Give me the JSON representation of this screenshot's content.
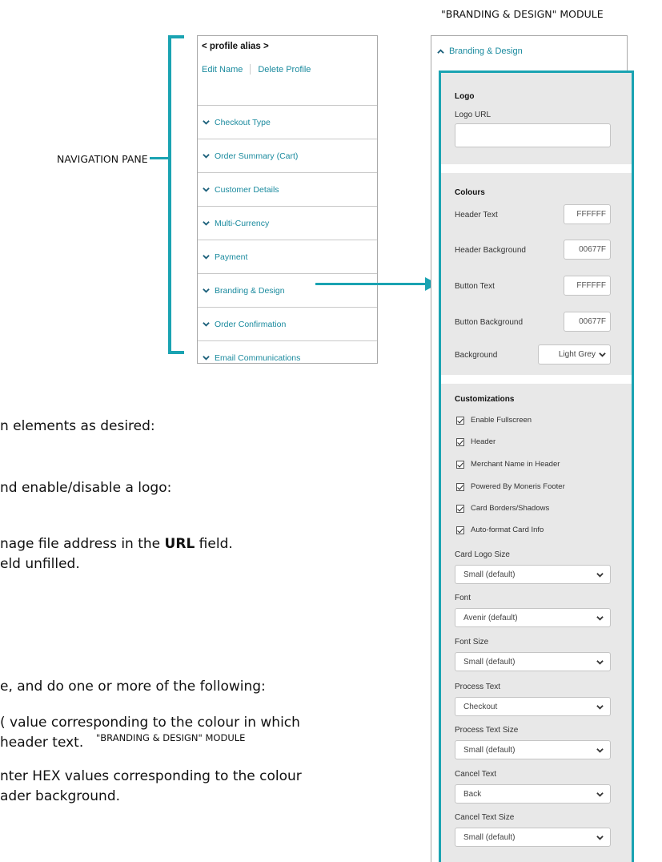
{
  "captions": {
    "module_top": "\"BRANDING & DESIGN\" MODULE",
    "module_overlay": "\"BRANDING & DESIGN\" MODULE",
    "nav_pane": "NAVIGATION PANE"
  },
  "nav": {
    "alias": "< profile alias >",
    "edit_name": "Edit Name",
    "delete_profile": "Delete Profile",
    "items": [
      {
        "label": "Checkout Type"
      },
      {
        "label": "Order Summary (Cart)"
      },
      {
        "label": "Customer Details"
      },
      {
        "label": "Multi-Currency"
      },
      {
        "label": "Payment"
      },
      {
        "label": "Branding & Design"
      },
      {
        "label": "Order Confirmation"
      },
      {
        "label": "Email Communications"
      }
    ]
  },
  "module": {
    "header": "Branding & Design",
    "logo": {
      "title": "Logo",
      "url_label": "Logo URL",
      "url_value": ""
    },
    "colours": {
      "title": "Colours",
      "header_text_label": "Header Text",
      "header_text_value": "FFFFFF",
      "header_bg_label": "Header Background",
      "header_bg_value": "00677F",
      "button_text_label": "Button Text",
      "button_text_value": "FFFFFF",
      "button_bg_label": "Button Background",
      "button_bg_value": "00677F",
      "background_label": "Background",
      "background_value": "Light Grey"
    },
    "customizations": {
      "title": "Customizations",
      "checkboxes": [
        {
          "label": "Enable Fullscreen",
          "checked": true
        },
        {
          "label": "Header",
          "checked": true
        },
        {
          "label": "Merchant Name in Header",
          "checked": true
        },
        {
          "label": "Powered By Moneris Footer",
          "checked": true
        },
        {
          "label": "Card Borders/Shadows",
          "checked": true
        },
        {
          "label": "Auto-format Card Info",
          "checked": true
        }
      ],
      "card_logo_size_label": "Card Logo Size",
      "card_logo_size_value": "Small (default)",
      "font_label": "Font",
      "font_value": "Avenir (default)",
      "font_size_label": "Font Size",
      "font_size_value": "Small (default)",
      "process_text_label": "Process Text",
      "process_text_value": "Checkout",
      "process_text_size_label": "Process Text Size",
      "process_text_size_value": "Small (default)",
      "cancel_text_label": "Cancel Text",
      "cancel_text_value": "Back",
      "cancel_text_size_label": "Cancel Text Size",
      "cancel_text_size_value": "Small (default)"
    }
  },
  "background_doc": {
    "line1": "n elements as desired:",
    "line2": "nd enable/disable a logo:",
    "line3_pre": "nage file address in the ",
    "line3_bold": "URL",
    "line3_post": " field.",
    "line4": "eld unfilled.",
    "line5": "e, and do one or more of the following:",
    "line6": "( value corresponding to the colour in which",
    "line7": "header text.",
    "line8": "nter HEX values corresponding to the colour",
    "line9": "ader background."
  },
  "colors": {
    "accent": "#1aa3b2",
    "link": "#1a8a9e",
    "panel_bg": "#e8e8e8"
  }
}
